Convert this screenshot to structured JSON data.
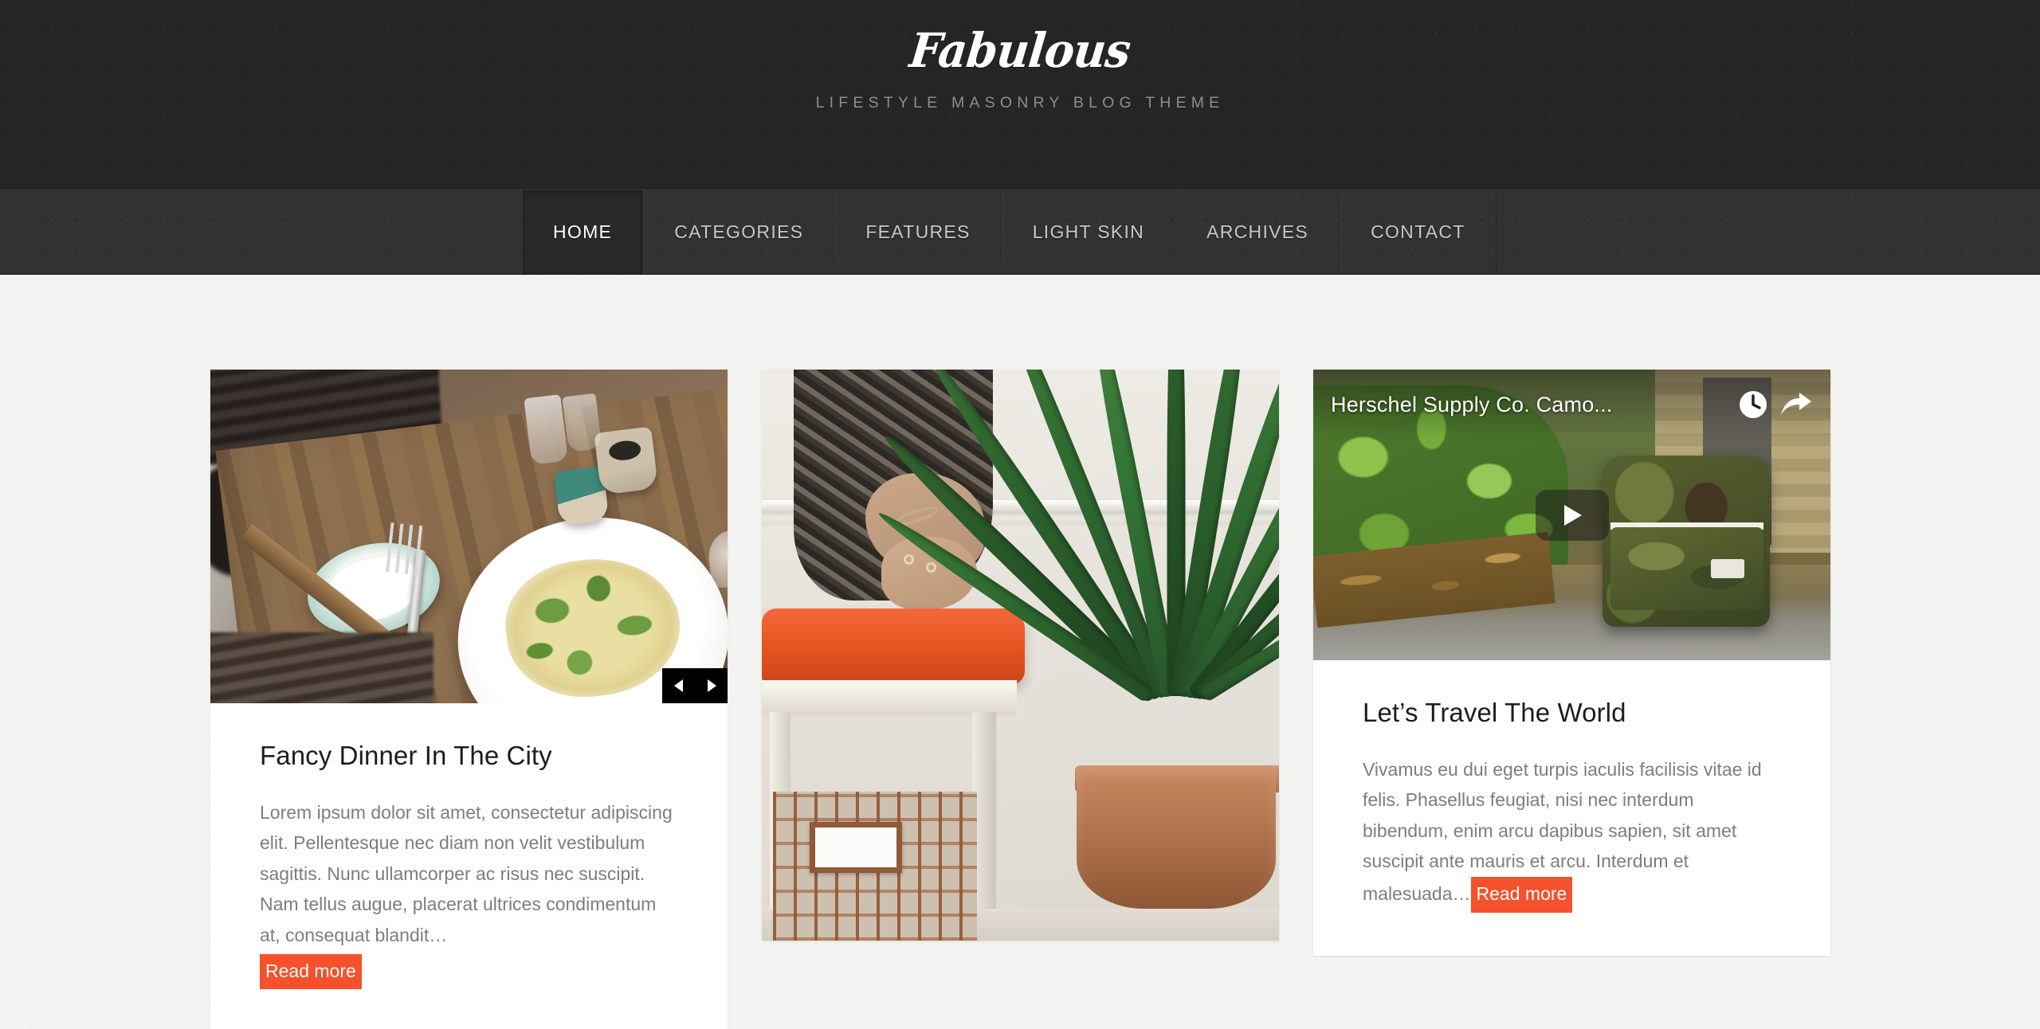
{
  "site": {
    "logo": "Fabulous",
    "tagline": "LIFESTYLE MASONRY BLOG THEME"
  },
  "nav": {
    "items": [
      {
        "label": "HOME",
        "active": true
      },
      {
        "label": "CATEGORIES",
        "active": false
      },
      {
        "label": "FEATURES",
        "active": false
      },
      {
        "label": "LIGHT SKIN",
        "active": false
      },
      {
        "label": "ARCHIVES",
        "active": false
      },
      {
        "label": "CONTACT",
        "active": false
      }
    ]
  },
  "posts": [
    {
      "id": "post-fancy-dinner",
      "media_type": "image-slider",
      "media_alt": "Plated pasta dish with fork on a wooden restaurant table",
      "title": "Fancy Dinner In The City",
      "excerpt": "Lorem ipsum dolor sit amet, consectetur adipiscing elit. Pellentesque nec diam non velit vestibulum sagittis. Nunc ullamcorper ac risus nec suscipit. Nam tellus augue, placerat ultrices condimentum at, consequat blandit…",
      "read_more": "Read more",
      "slider": {
        "prev": "◀",
        "next": "▶"
      }
    },
    {
      "id": "post-interior",
      "media_type": "image",
      "media_alt": "Woman seated beside an orange cushion stool and a snake plant in a terracotta pot",
      "title": "",
      "excerpt": "",
      "read_more": ""
    },
    {
      "id": "post-travel-world",
      "media_type": "video",
      "media_alt": "Camo Herschel Supply Co. backpack outdoors next to green bushes",
      "video_title": "Herschel Supply Co. Camo...",
      "title": "Let’s Travel The World",
      "excerpt": "Vivamus eu dui eget turpis iaculis facilisis vitae id felis. Phasellus feugiat, nisi nec interdum bibendum, enim arcu dapibus sapien, sit amet suscipit ante mauris et arcu. Interdum et malesuada…",
      "read_more": "Read more"
    }
  ],
  "colors": {
    "accent": "#f4512c",
    "header_bg": "#262524",
    "nav_bg": "#333231",
    "nav_active_bg": "#2a2928",
    "page_bg": "#f3f3f1",
    "card_bg": "#ffffff",
    "title_text": "#1d1d1b",
    "body_text": "#7d7d7b",
    "tagline_text": "#8d8d8b"
  }
}
